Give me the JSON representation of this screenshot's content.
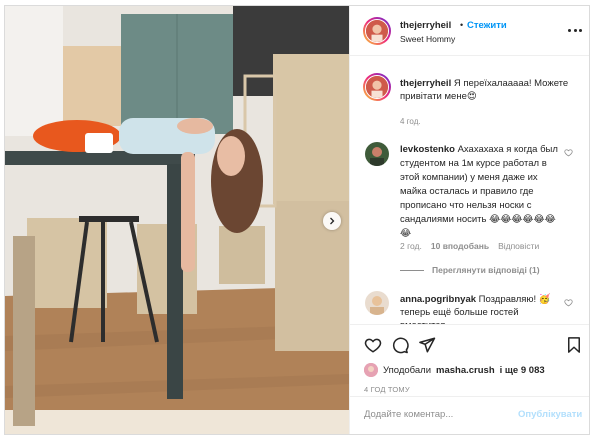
{
  "post": {
    "username": "thejerryheil",
    "separator": "•",
    "follow_label": "Стежити",
    "location": "Sweet Hommy",
    "caption_username": "thejerryheil",
    "caption_text": "Я переїхалааааа! Можете привітати мене😍",
    "caption_time": "4 год.",
    "icons": {
      "more": "more-dots-icon",
      "next": "chevron-right-icon"
    }
  },
  "comments": [
    {
      "username": "levkostenko",
      "text": "Ахахахаха я когда был студентом на 1м курсе работал в этой компании) у меня даже их майка осталась и правило где прописано что нельзя носки с сандалиями носить 😂😂😂😂😂😂😂",
      "time": "2 год.",
      "likes": "10 вподобань",
      "reply": "Відповісти",
      "view_replies": "Переглянути відповіді (1)"
    },
    {
      "username": "anna.pogribnyak",
      "text": "Поздравляю! 🥳теперь ещё больше гостей вместится"
    }
  ],
  "actions": {
    "liked_by_prefix": "Уподобали",
    "liked_by_user": "masha.crush",
    "liked_by_suffix": "і ще 9 083",
    "posted_time": "4 ГОД ТОМУ",
    "comment_placeholder": "Додайте коментар...",
    "publish_label": "Опублікувати",
    "icons": [
      "heart-icon",
      "comment-icon",
      "share-icon",
      "bookmark-icon"
    ]
  },
  "colors": {
    "link": "#0095f6",
    "muted": "#8e8e8e",
    "publish_disabled": "#b2dffc"
  }
}
